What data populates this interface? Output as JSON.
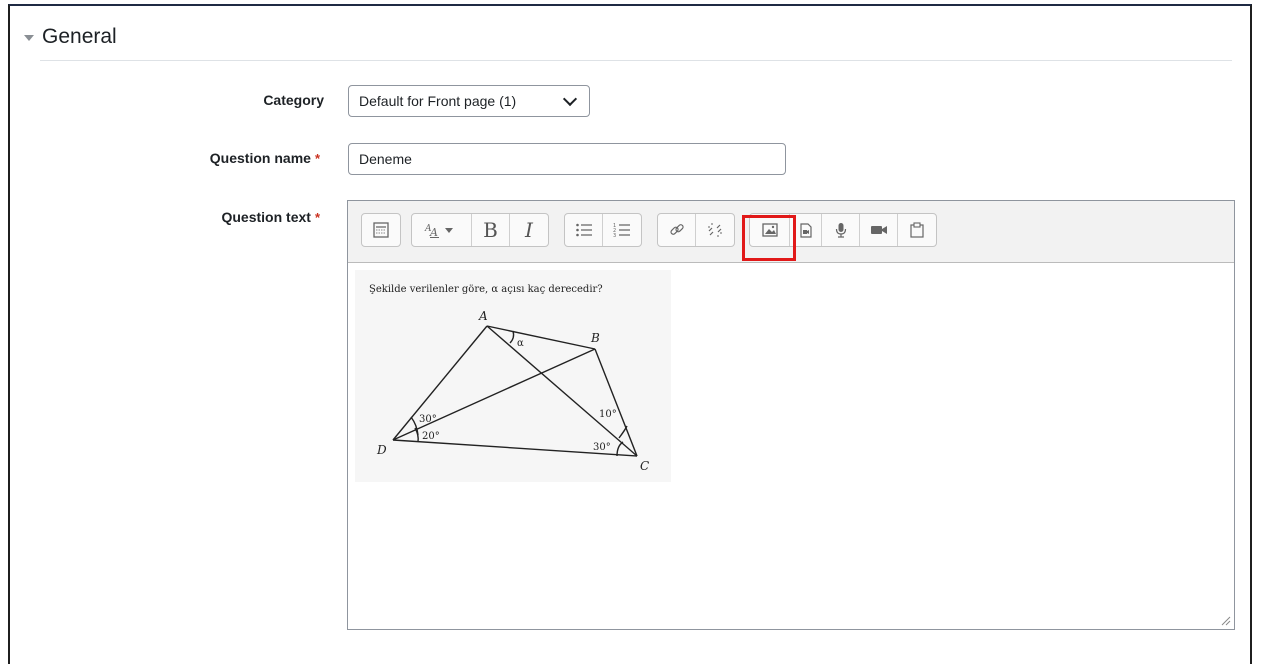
{
  "section": {
    "title": "General"
  },
  "category": {
    "label": "Category",
    "value": "Default for Front page (1)"
  },
  "question_name": {
    "label": "Question name",
    "required_mark": "*",
    "value": "Deneme"
  },
  "question_text": {
    "label": "Question text",
    "required_mark": "*",
    "toolbar": {
      "groups": [
        [
          "toggle-toolbar-icon"
        ],
        [
          "font-style-icon",
          "bold-icon",
          "italic-icon"
        ],
        [
          "unordered-list-icon",
          "ordered-list-icon"
        ],
        [
          "link-icon",
          "unlink-icon"
        ],
        [
          "image-icon",
          "media-icon",
          "audio-record-icon",
          "video-record-icon",
          "manage-files-icon"
        ]
      ],
      "bold": "B",
      "italic": "I",
      "highlighted_button": "image-icon",
      "highlight_color": "#e11919"
    },
    "figure": {
      "caption": "Şekilde verilenler göre, α açısı kaç derecedir?",
      "points": [
        "A",
        "B",
        "C",
        "D"
      ],
      "angles": [
        "α",
        "30°",
        "20°",
        "10°",
        "30°"
      ]
    }
  }
}
